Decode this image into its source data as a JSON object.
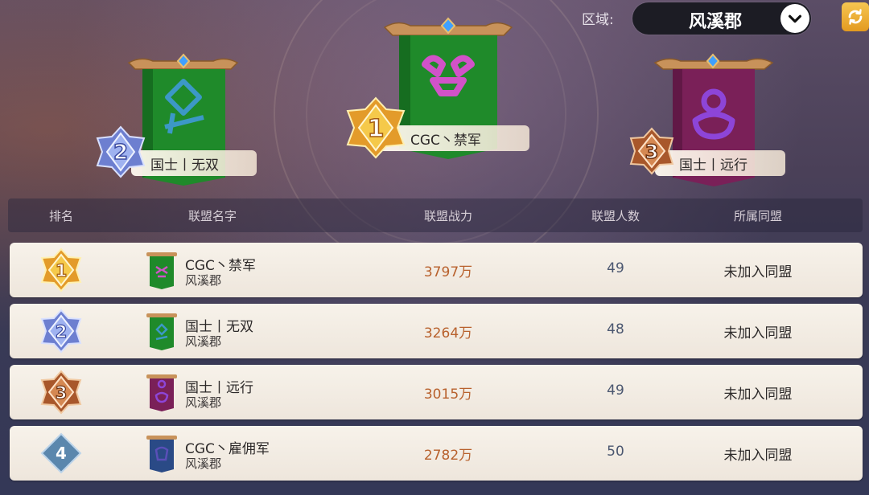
{
  "header": {
    "region_label": "区域:",
    "region_value": "风溪郡"
  },
  "podium": [
    {
      "rank": "2",
      "name": "国士丨无双"
    },
    {
      "rank": "1",
      "name": "CGC丶禁军"
    },
    {
      "rank": "3",
      "name": "国士丨远行"
    }
  ],
  "table": {
    "columns": [
      "排名",
      "联盟名字",
      "联盟战力",
      "联盟人数",
      "所属同盟"
    ],
    "rows": [
      {
        "rank": "1",
        "name": "CGC丶禁军",
        "region": "风溪郡",
        "power": "3797万",
        "members": "49",
        "league": "未加入同盟"
      },
      {
        "rank": "2",
        "name": "国士丨无双",
        "region": "风溪郡",
        "power": "3264万",
        "members": "48",
        "league": "未加入同盟"
      },
      {
        "rank": "3",
        "name": "国士丨远行",
        "region": "风溪郡",
        "power": "3015万",
        "members": "49",
        "league": "未加入同盟"
      },
      {
        "rank": "4",
        "name": "CGC丶雇佣军",
        "region": "风溪郡",
        "power": "2782万",
        "members": "50",
        "league": "未加入同盟"
      }
    ]
  },
  "colors": {
    "banner_green": "#1f8a2a",
    "banner_maroon": "#7a2058",
    "banner_blue": "#2a4a86",
    "gold": "#e8b341",
    "silver": "#8aa0e6",
    "bronze": "#b96b3a",
    "power_text": "#b8612d"
  },
  "icons": {
    "chevron": "chevron-down-icon",
    "refresh": "refresh-icon",
    "rank_1": "gold-medal-icon",
    "rank_2": "silver-medal-icon",
    "rank_3": "bronze-medal-icon",
    "rank_4": "diamond-rank-icon"
  }
}
